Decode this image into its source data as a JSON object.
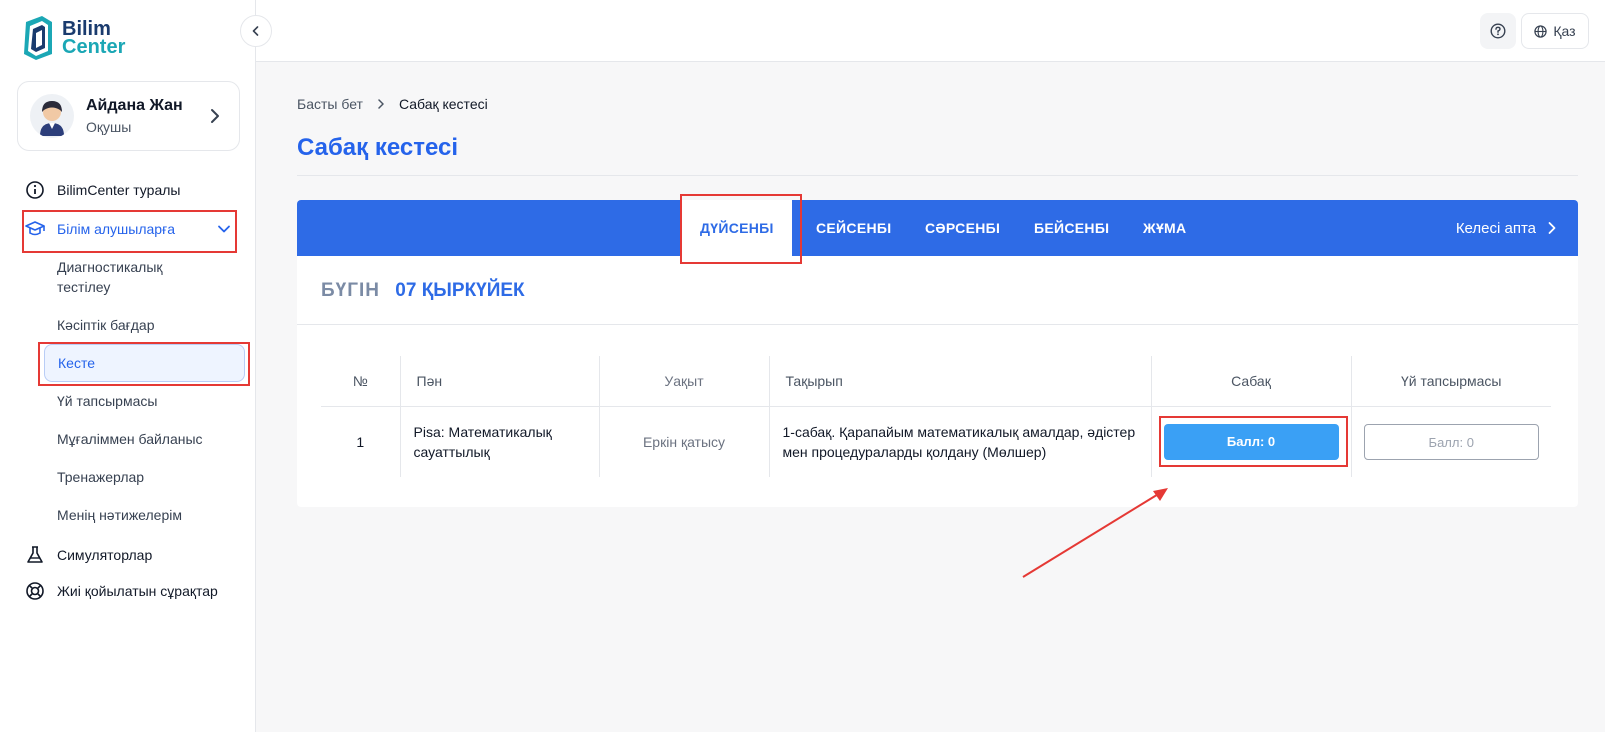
{
  "brand": {
    "line1": "Bilim",
    "line2": "Center"
  },
  "profile": {
    "name": "Айдана Жан",
    "role": "Оқушы"
  },
  "nav": {
    "about": "BilimCenter туралы",
    "students": "Білім алушыларға",
    "sub": {
      "diagnostic": "Диагностикалық тестілеу",
      "career": "Кәсіптік бағдар",
      "schedule": "Кесте",
      "homework": "Үй тапсырмасы",
      "contact_teacher": "Мұғаліммен байланыс",
      "trainers": "Тренажерлар",
      "results": "Менің нәтижелерім"
    },
    "simulators": "Симуляторлар",
    "faq": "Жиі қойылатын сұрақтар"
  },
  "topbar": {
    "lang": "Қаз"
  },
  "breadcrumb": {
    "home": "Басты бет",
    "current": "Сабақ кестесі"
  },
  "page_title": "Сабақ кестесі",
  "tabs": [
    "ДҮЙСЕНБІ",
    "СЕЙСЕНБІ",
    "СӘРСЕНБІ",
    "БЕЙСЕНБІ",
    "ЖҰМА"
  ],
  "next_week": "Келесі апта",
  "today": {
    "label": "БҮГІН",
    "date": "07 ҚЫРКҮЙЕК"
  },
  "table": {
    "headers": [
      "№",
      "Пән",
      "Уақыт",
      "Тақырып",
      "Сабақ",
      "Үй тапсырмасы"
    ],
    "rows": [
      {
        "num": "1",
        "subject": "Pisa: Математикалық сауаттылық",
        "time": "Еркін қатысу",
        "topic": "1-сабақ. Қарапайым математикалық амалдар, әдістер мен процедураларды қолдану (Мөлшер)",
        "lesson_btn": "Балл: 0",
        "hw_btn": "Балл: 0"
      }
    ]
  },
  "colors": {
    "accent": "#2e6be6",
    "primary_button": "#3aa0f5",
    "annotation": "#e53935"
  }
}
